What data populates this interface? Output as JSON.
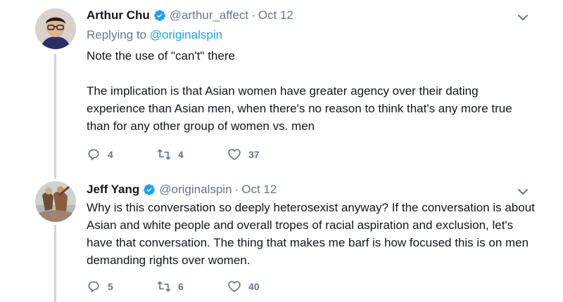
{
  "tweets": [
    {
      "name": "Arthur Chu",
      "handle": "@arthur_affect",
      "separator": "·",
      "date": "Oct 12",
      "replying_prefix": "Replying to",
      "replying_to": "@originalspin",
      "paragraphs": [
        "Note the use of \"can't\" there",
        "The implication is that Asian women have greater agency over their dating experience than Asian men, when there's no reason to think that's any more true than for any other group of women vs. men"
      ],
      "replies": "4",
      "retweets": "4",
      "likes": "37"
    },
    {
      "name": "Jeff Yang",
      "handle": "@originalspin",
      "separator": "·",
      "date": "Oct 12",
      "paragraphs": [
        "Why is this conversation so deeply heterosexist anyway? If the conversation is about Asian and white people and overall tropes of racial aspiration and exclusion, let's have that conversation. The thing that makes me barf is how focused this is on men demanding rights over women."
      ],
      "replies": "5",
      "retweets": "6",
      "likes": "40"
    }
  ],
  "colors": {
    "text": "#14171a",
    "secondary": "#657786",
    "link": "#1da1f2",
    "thread_line": "#ccd6dd",
    "verified": "#1da1f2"
  },
  "icons": [
    "verified-badge-icon",
    "chevron-down-icon",
    "reply-icon",
    "retweet-icon",
    "like-icon"
  ]
}
